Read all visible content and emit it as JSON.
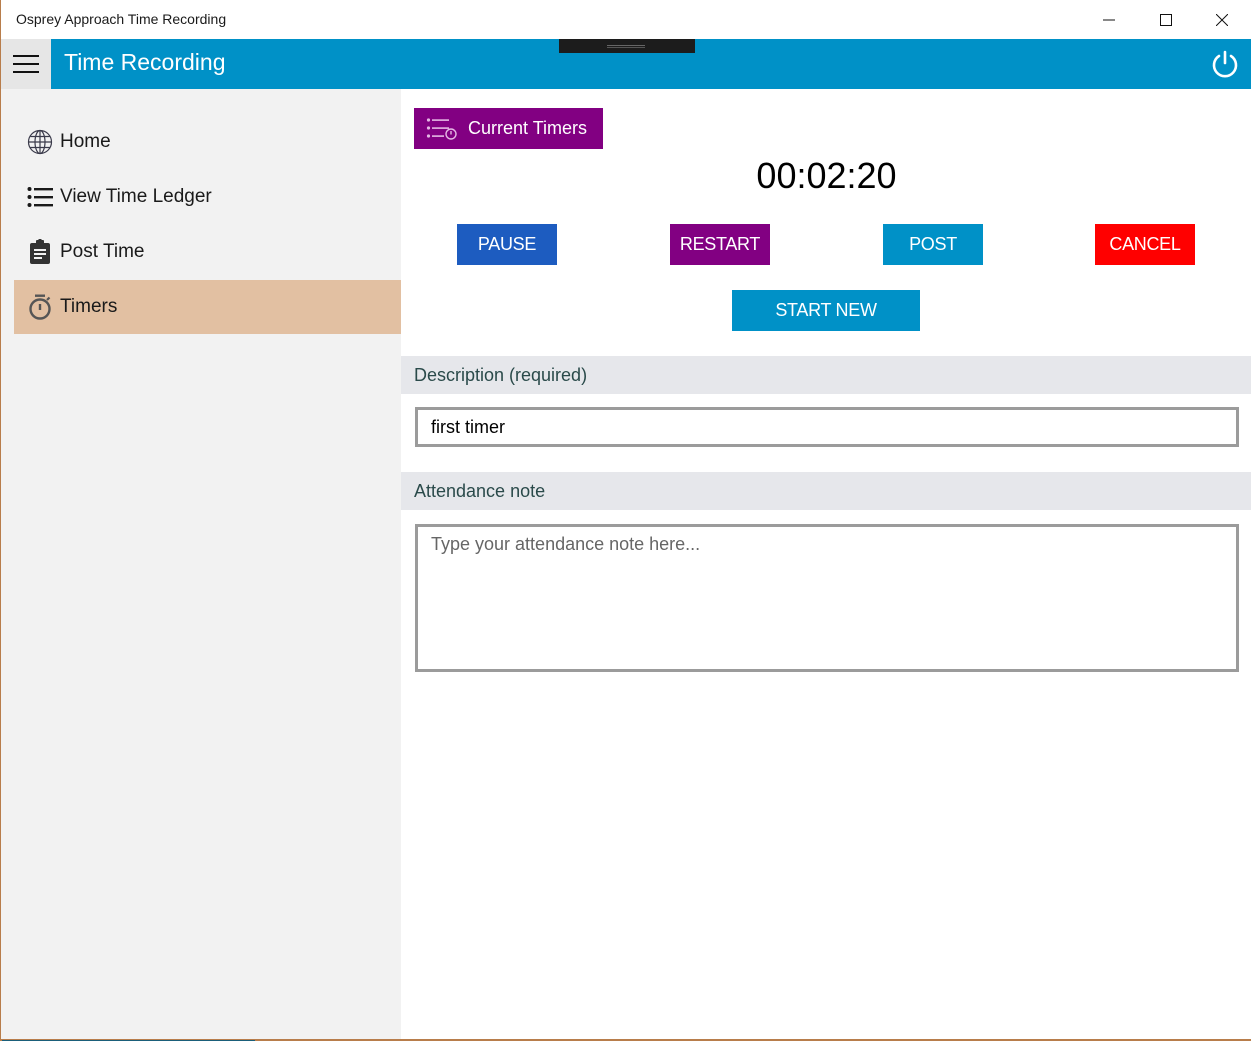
{
  "window": {
    "title": "Osprey Approach Time Recording",
    "controls": [
      "minimize",
      "maximize",
      "close"
    ]
  },
  "appbar": {
    "title": "Time Recording",
    "menu_icon": "hamburger-icon",
    "power_icon": "power-icon",
    "color": "#0091c7"
  },
  "sidebar": {
    "items": [
      {
        "label": "Home",
        "icon": "globe-icon",
        "active": false
      },
      {
        "label": "View Time Ledger",
        "icon": "list-icon",
        "active": false
      },
      {
        "label": "Post Time",
        "icon": "clipboard-icon",
        "active": false
      },
      {
        "label": "Timers",
        "icon": "stopwatch-icon",
        "active": true
      }
    ],
    "active_color": "#e2c0a2"
  },
  "main": {
    "current_timers_label": "Current Timers",
    "timer_value": "00:02:20",
    "buttons": {
      "pause": "PAUSE",
      "restart": "RESTART",
      "post": "POST",
      "cancel": "CANCEL",
      "start_new": "START NEW"
    },
    "button_colors": {
      "pause": "#1d5cc0",
      "restart": "#820082",
      "post": "#0091c7",
      "cancel": "#ff0000",
      "start_new": "#0091c7"
    },
    "description": {
      "label": "Description (required)",
      "value": "first timer"
    },
    "attendance": {
      "label": "Attendance note",
      "value": "",
      "placeholder": "Type your attendance note here..."
    }
  }
}
